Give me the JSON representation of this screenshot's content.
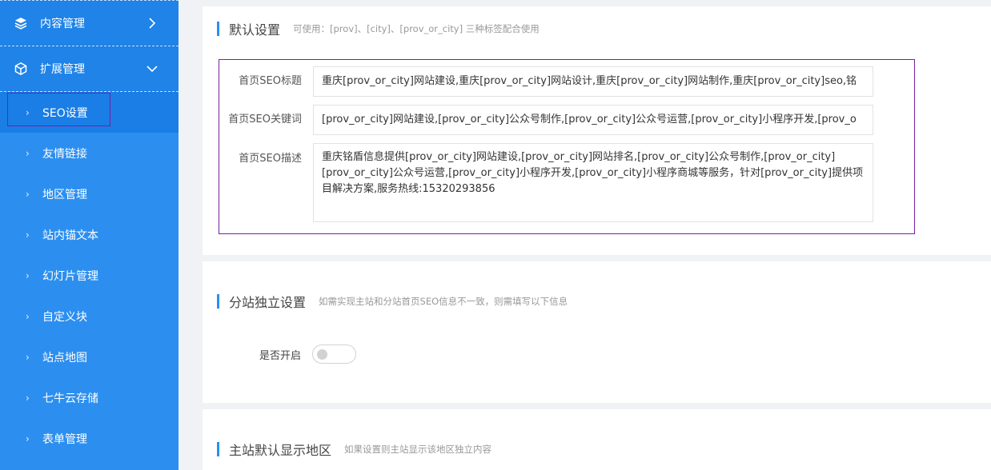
{
  "sidebar": {
    "groups": [
      {
        "label": "内容管理",
        "icon": "layers-icon",
        "expanded": false
      },
      {
        "label": "扩展管理",
        "icon": "cube-icon",
        "expanded": true
      }
    ],
    "items": [
      {
        "label": "SEO设置",
        "active": true
      },
      {
        "label": "友情链接"
      },
      {
        "label": "地区管理"
      },
      {
        "label": "站内锚文本"
      },
      {
        "label": "幻灯片管理"
      },
      {
        "label": "自定义块"
      },
      {
        "label": "站点地图"
      },
      {
        "label": "七牛云存储"
      },
      {
        "label": "表单管理"
      }
    ]
  },
  "default_settings": {
    "title": "默认设置",
    "hint": "可使用：[prov]、[city]、[prov_or_city] 三种标签配合使用",
    "fields": [
      {
        "label": "首页SEO标题",
        "value": "重庆[prov_or_city]网站建设,重庆[prov_or_city]网站设计,重庆[prov_or_city]网站制作,重庆[prov_or_city]seo,铭"
      },
      {
        "label": "首页SEO关键词",
        "value": "[prov_or_city]网站建设,[prov_or_city]公众号制作,[prov_or_city]公众号运营,[prov_or_city]小程序开发,[prov_o"
      },
      {
        "label": "首页SEO描述",
        "value": "重庆铭盾信息提供[prov_or_city]网站建设,[prov_or_city]网站排名,[prov_or_city]公众号制作,[prov_or_city][prov_or_city]公众号运营,[prov_or_city]小程序开发,[prov_or_city]小程序商城等服务，针对[prov_or_city]提供项目解决方案,服务热线:15320293856"
      }
    ]
  },
  "substation": {
    "title": "分站独立设置",
    "hint": "如需实现主站和分站首页SEO信息不一致，则需填写以下信息",
    "switch_label": "是否开启",
    "enabled": false
  },
  "main_region": {
    "title": "主站默认显示地区",
    "hint": "如果设置则主站显示该地区独立内容"
  },
  "colors": {
    "sidebar_bg": "#2c8ff0",
    "accent": "#2c8ff0",
    "highlight_outline": "#7a1fa0"
  }
}
